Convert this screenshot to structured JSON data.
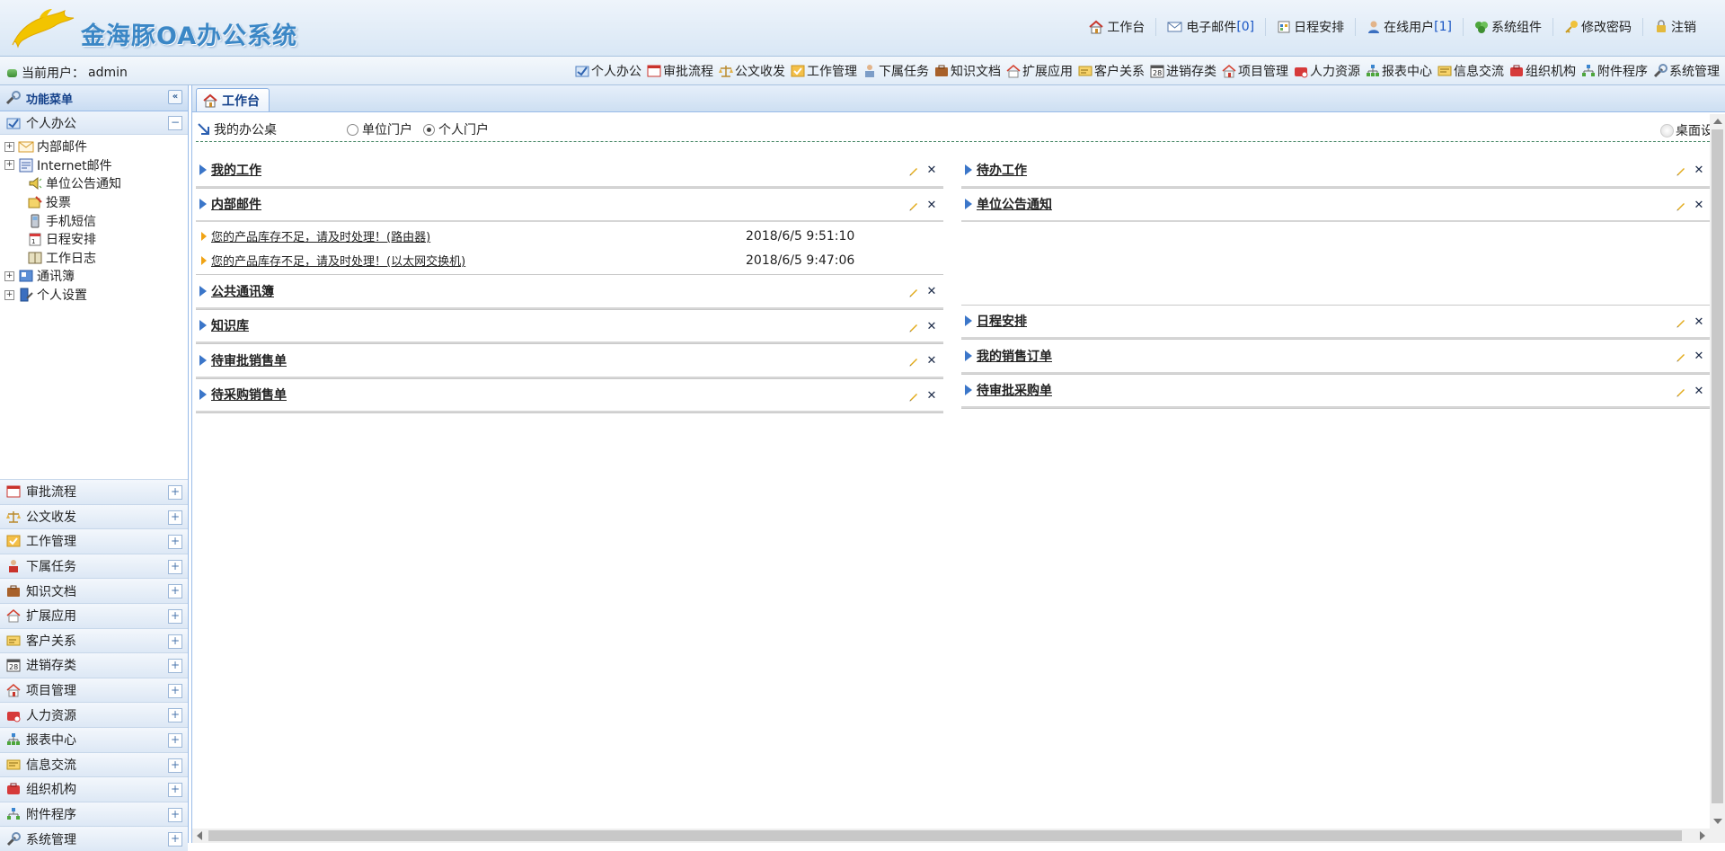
{
  "app": {
    "title": "金海豚OA办公系统"
  },
  "topnav": [
    {
      "label": "工作台",
      "icon": "home-icon"
    },
    {
      "label": "电子邮件",
      "count": "[0]",
      "icon": "mail-icon"
    },
    {
      "label": "日程安排",
      "icon": "calendar-icon"
    },
    {
      "label": "在线用户",
      "count": "[1]",
      "icon": "user-icon"
    },
    {
      "label": "系统组件",
      "icon": "puzzle-icon"
    },
    {
      "label": "修改密码",
      "icon": "key-icon"
    },
    {
      "label": "注销",
      "icon": "logout-icon"
    }
  ],
  "userbar": {
    "label": "当前用户：",
    "username": "admin"
  },
  "modules": [
    {
      "label": "个人办公",
      "icon": "personal-office-icon"
    },
    {
      "label": "审批流程",
      "icon": "approval-icon"
    },
    {
      "label": "公文收发",
      "icon": "scales-icon"
    },
    {
      "label": "工作管理",
      "icon": "work-icon"
    },
    {
      "label": "下属任务",
      "icon": "person-task-icon"
    },
    {
      "label": "知识文档",
      "icon": "briefcase-icon"
    },
    {
      "label": "扩展应用",
      "icon": "house-ext-icon"
    },
    {
      "label": "客户关系",
      "icon": "customer-icon"
    },
    {
      "label": "进销存类",
      "icon": "calendar-28-icon"
    },
    {
      "label": "项目管理",
      "icon": "project-icon"
    },
    {
      "label": "人力资源",
      "icon": "hr-icon"
    },
    {
      "label": "报表中心",
      "icon": "report-icon"
    },
    {
      "label": "信息交流",
      "icon": "message-icon"
    },
    {
      "label": "组织机构",
      "icon": "org-icon"
    },
    {
      "label": "附件程序",
      "icon": "attach-icon"
    },
    {
      "label": "系统管理",
      "icon": "system-icon"
    }
  ],
  "sidebar": {
    "title": "功能菜单",
    "collapse_glyph": "«",
    "personal_title": "个人办公",
    "tree": [
      {
        "label": "内部邮件",
        "expandable": true,
        "icon": "envelope-icon"
      },
      {
        "label": "Internet邮件",
        "expandable": true,
        "icon": "internet-mail-icon"
      },
      {
        "label": "单位公告通知",
        "expandable": false,
        "icon": "speaker-icon"
      },
      {
        "label": "投票",
        "expandable": false,
        "icon": "vote-icon"
      },
      {
        "label": "手机短信",
        "expandable": false,
        "icon": "phone-icon"
      },
      {
        "label": "日程安排",
        "expandable": false,
        "icon": "schedule-icon"
      },
      {
        "label": "工作日志",
        "expandable": false,
        "icon": "book-icon"
      },
      {
        "label": "通讯簿",
        "expandable": true,
        "icon": "addressbook-icon"
      },
      {
        "label": "个人设置",
        "expandable": true,
        "icon": "settings-icon"
      }
    ],
    "accordion": [
      {
        "label": "审批流程"
      },
      {
        "label": "公文收发"
      },
      {
        "label": "工作管理"
      },
      {
        "label": "下属任务"
      },
      {
        "label": "知识文档"
      },
      {
        "label": "扩展应用"
      },
      {
        "label": "客户关系"
      },
      {
        "label": "进销存类"
      },
      {
        "label": "项目管理"
      },
      {
        "label": "人力资源"
      },
      {
        "label": "报表中心"
      },
      {
        "label": "信息交流"
      },
      {
        "label": "组织机构"
      },
      {
        "label": "附件程序"
      },
      {
        "label": "系统管理"
      }
    ]
  },
  "main": {
    "tab": "工作台",
    "desk_title": "我的办公桌",
    "radios": [
      {
        "label": "单位门户",
        "checked": false
      },
      {
        "label": "个人门户",
        "checked": true
      }
    ],
    "desk_settings": "桌面设",
    "left_portlets": [
      {
        "title": "我的工作"
      },
      {
        "title": "内部邮件",
        "items": [
          {
            "subject": "您的产品库存不足，请及时处理！(路由器)",
            "time": "2018/6/5 9:51:10"
          },
          {
            "subject": "您的产品库存不足，请及时处理！(以太网交换机)",
            "time": "2018/6/5 9:47:06"
          }
        ]
      },
      {
        "title": "公共通讯簿"
      },
      {
        "title": "知识库"
      },
      {
        "title": "待审批销售单"
      },
      {
        "title": "待采购销售单"
      }
    ],
    "right_portlets": [
      {
        "title": "待办工作"
      },
      {
        "title": "单位公告通知"
      },
      {
        "title": "日程安排"
      },
      {
        "title": "我的销售订单"
      },
      {
        "title": "待审批采购单"
      }
    ]
  },
  "colors": {
    "accent": "#3b76c9",
    "header_bg": "#d9e7f5",
    "border": "#99bbe8",
    "mail_marker": "#f0a314"
  }
}
